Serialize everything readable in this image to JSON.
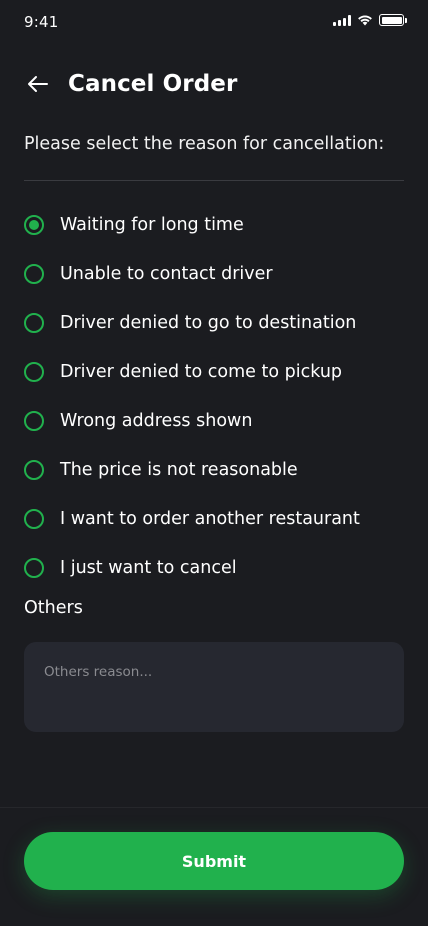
{
  "status_bar": {
    "time": "9:41"
  },
  "header": {
    "title": "Cancel Order"
  },
  "prompt": "Please select the reason for cancellation:",
  "reasons": [
    {
      "label": "Waiting for long time",
      "selected": true
    },
    {
      "label": "Unable to contact driver",
      "selected": false
    },
    {
      "label": "Driver denied to go to destination",
      "selected": false
    },
    {
      "label": "Driver denied to come to pickup",
      "selected": false
    },
    {
      "label": "Wrong address shown",
      "selected": false
    },
    {
      "label": "The price is not reasonable",
      "selected": false
    },
    {
      "label": "I want to order another restaurant",
      "selected": false
    },
    {
      "label": "I just want to cancel",
      "selected": false
    }
  ],
  "others": {
    "label": "Others",
    "placeholder": "Others reason..."
  },
  "submit_label": "Submit",
  "colors": {
    "accent": "#21b14d",
    "background": "#1b1c20",
    "input_bg": "#262830"
  }
}
